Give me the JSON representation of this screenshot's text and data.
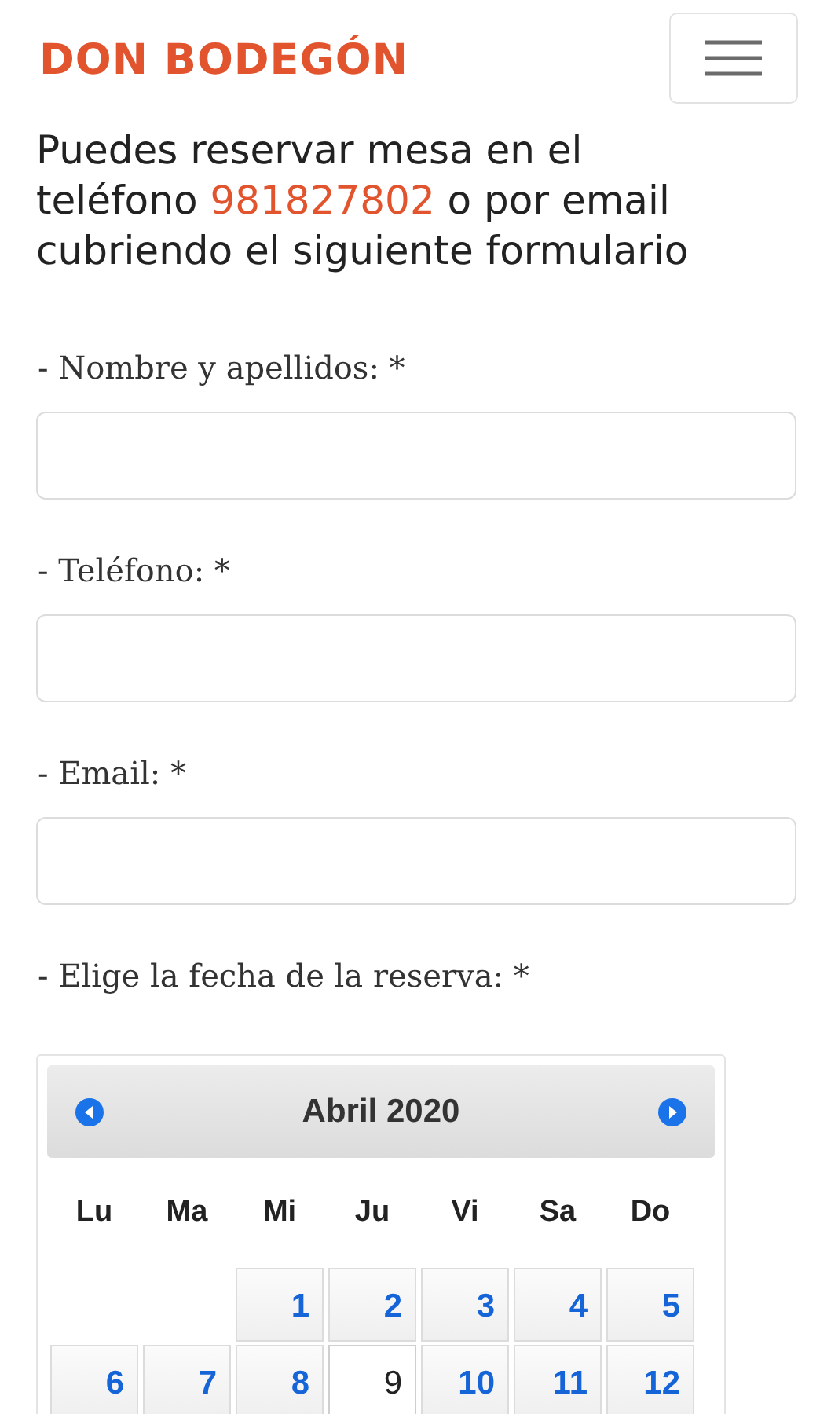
{
  "header": {
    "logo": "DON BODEGÓN"
  },
  "intro": {
    "before": "Puedes reservar mesa en el teléfono",
    "phone": "981827802",
    "after": "o por email cubriendo el siguiente formulario"
  },
  "fields": [
    {
      "label": "- Nombre y apellidos: *"
    },
    {
      "label": "- Teléfono: *"
    },
    {
      "label": "- Email: *"
    }
  ],
  "date_label": "- Elige la fecha de la reserva: *",
  "calendar": {
    "title": "Abril 2020",
    "weekdays": [
      "Lu",
      "Ma",
      "Mi",
      "Ju",
      "Vi",
      "Sa",
      "Do"
    ],
    "weeks": [
      [
        {
          "kind": "empty"
        },
        {
          "kind": "empty"
        },
        {
          "kind": "day",
          "day": "1",
          "selected": false
        },
        {
          "kind": "day",
          "day": "2",
          "selected": false
        },
        {
          "kind": "day",
          "day": "3",
          "selected": false
        },
        {
          "kind": "day",
          "day": "4",
          "selected": false
        },
        {
          "kind": "day",
          "day": "5",
          "selected": false
        }
      ],
      [
        {
          "kind": "day",
          "day": "6",
          "selected": false
        },
        {
          "kind": "day",
          "day": "7",
          "selected": false
        },
        {
          "kind": "day",
          "day": "8",
          "selected": false
        },
        {
          "kind": "day",
          "day": "9",
          "selected": true
        },
        {
          "kind": "day",
          "day": "10",
          "selected": false
        },
        {
          "kind": "day",
          "day": "11",
          "selected": false
        },
        {
          "kind": "day",
          "day": "12",
          "selected": false
        }
      ]
    ]
  }
}
